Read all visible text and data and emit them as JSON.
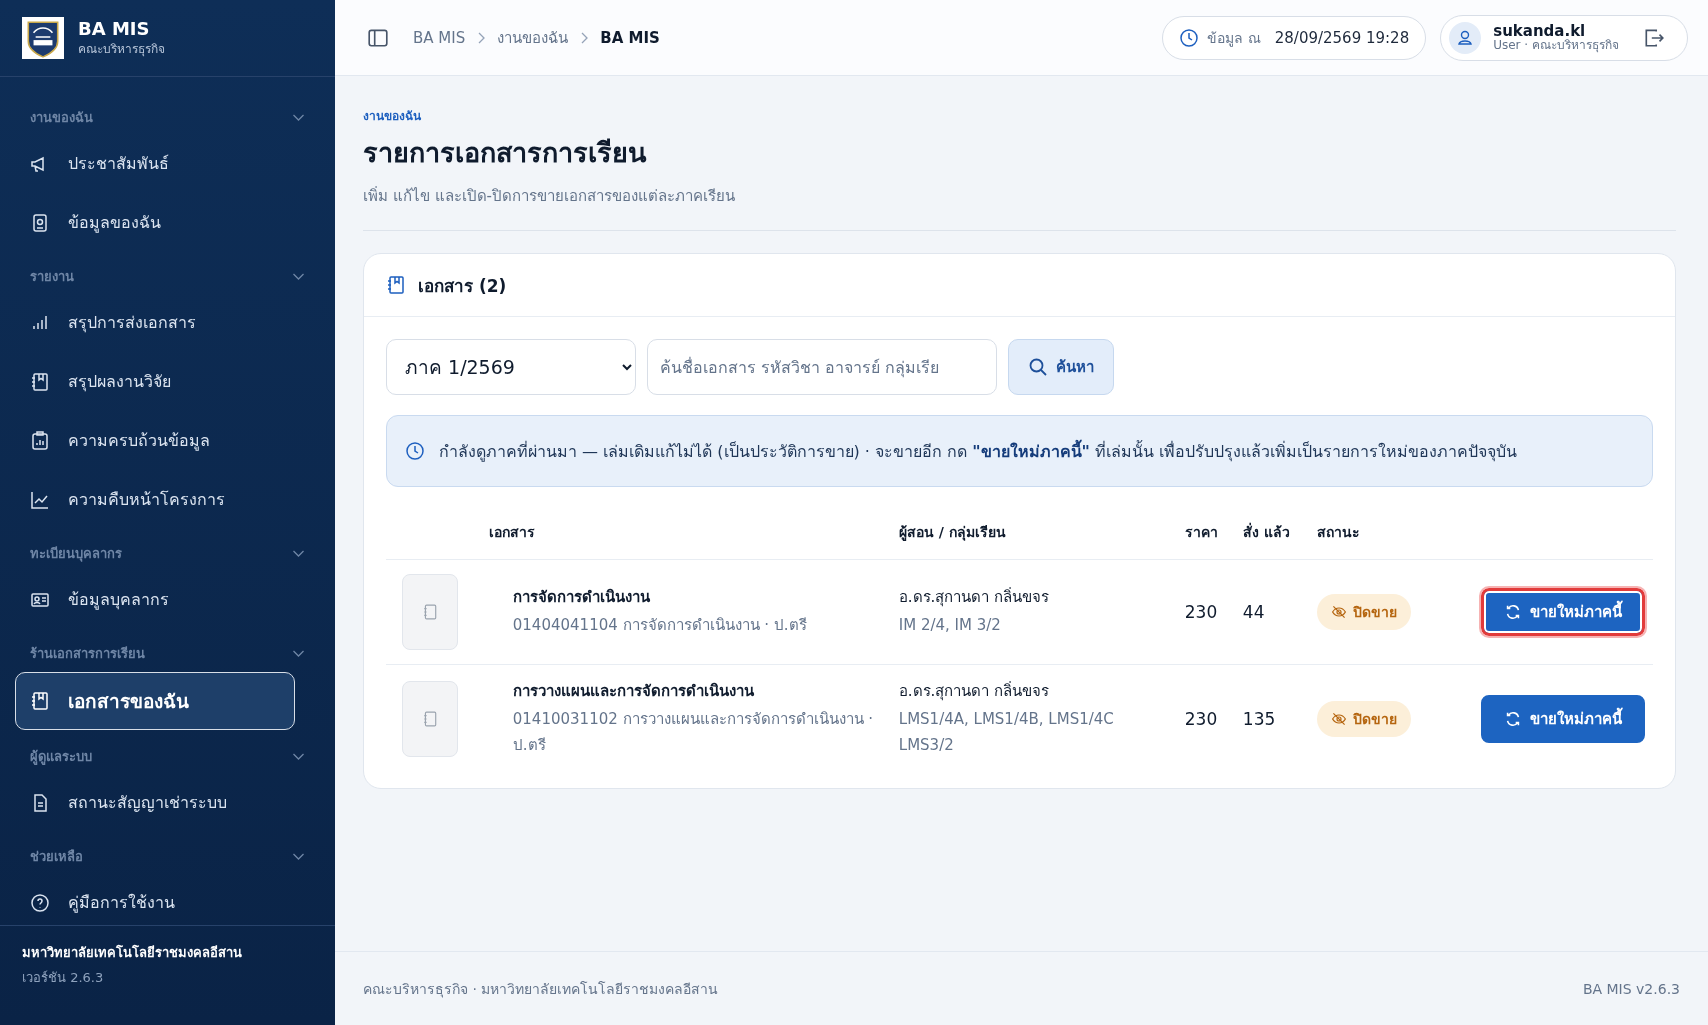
{
  "sidebar": {
    "brand": {
      "title": "BA MIS",
      "subtitle": "คณะบริหารธุรกิจ"
    },
    "sections": [
      {
        "title": "งานของฉัน",
        "expanded": true,
        "items": [
          {
            "label": "ประชาสัมพันธ์",
            "kind": "megaphone",
            "selected": false
          },
          {
            "label": "ข้อมูลของฉัน",
            "kind": "badge",
            "selected": false
          }
        ]
      },
      {
        "title": "รายงาน",
        "expanded": true,
        "items": [
          {
            "label": "สรุปการส่งเอกสาร",
            "kind": "bars",
            "selected": false
          },
          {
            "label": "สรุปผลงานวิจัย",
            "kind": "notebook",
            "selected": false
          },
          {
            "label": "ความครบถ้วนข้อมูล",
            "kind": "clipboard",
            "selected": false
          },
          {
            "label": "ความคืบหน้าโครงการ",
            "kind": "trend",
            "selected": false
          }
        ]
      },
      {
        "title": "ทะเบียนบุคลากร",
        "expanded": true,
        "items": [
          {
            "label": "ข้อมูลบุคลากร",
            "kind": "idcard",
            "selected": false
          }
        ]
      },
      {
        "title": "ร้านเอกสารการเรียน",
        "expanded": true,
        "items": [
          {
            "label": "เอกสารของฉัน",
            "kind": "notebook",
            "selected": true
          }
        ]
      },
      {
        "title": "ผู้ดูแลระบบ",
        "expanded": true,
        "items": [
          {
            "label": "สถานะสัญญาเช่าระบบ",
            "kind": "file",
            "selected": false
          }
        ]
      },
      {
        "title": "ช่วยเหลือ",
        "expanded": true,
        "items": [
          {
            "label": "คู่มือการใช้งาน",
            "kind": "help",
            "selected": false
          }
        ]
      }
    ],
    "footer": {
      "org": "มหาวิทยาลัยเทคโนโลยีราชมงคลอีสาน",
      "version": "เวอร์ชัน 2.6.3"
    }
  },
  "topbar": {
    "breadcrumb": [
      "BA MIS",
      "งานของฉัน",
      "BA MIS"
    ],
    "data_time_label": "ข้อมูล ณ",
    "data_time": "28/09/2569 19:28",
    "user": {
      "name": "sukanda.kl",
      "role": "User · คณะบริหารธุรกิจ"
    }
  },
  "page": {
    "eyebrow": "งานของฉัน",
    "title": "รายการเอกสารการเรียน",
    "subtitle": "เพิ่ม แก้ไข และเปิด-ปิดการขายเอกสารของแต่ละภาคเรียน"
  },
  "card": {
    "title": "เอกสาร (2)",
    "filters": {
      "term": "ภาค 1/2569",
      "search_placeholder": "ค้นชื่อเอกสาร รหัสวิชา อาจารย์ กลุ่มเรีย",
      "search_button": "ค้นหา"
    },
    "notice": "กำลังดูภาคที่ผ่านมา — เล่มเดิมแก้ไม่ได้ (เป็นประวัติการขาย) · จะขายอีก กด **\"ขายใหม่ภาคนี้\"** ที่เล่มนั้น เพื่อปรับปรุงแล้วเพิ่มเป็นรายการใหม่ของภาคปัจจุบัน",
    "table": {
      "columns": [
        "เอกสาร",
        "ผู้สอน / กลุ่มเรียน",
        "ราคา",
        "สั่ง แล้ว",
        "สถานะ"
      ],
      "rows": [
        {
          "title": "การจัดการดำเนินงาน",
          "detail": "01404041104 การจัดการดำเนินงาน · ป.ตรี",
          "teacher": "อ.ดร.สุกานดา กลิ่นขจร",
          "groups": "IM 2/4, IM 3/2",
          "price": "230",
          "ordered": "44",
          "status": "ปิดขาย",
          "action": "ขายใหม่ภาคนี้",
          "highlighted": true
        },
        {
          "title": "การวางแผนและการจัดการดำเนินงาน",
          "detail": "01410031102 การวางแผนและการจัดการดำเนินงาน · ป.ตรี",
          "teacher": "อ.ดร.สุกานดา กลิ่นขจร",
          "groups": "LMS1/4A, LMS1/4B, LMS1/4C LMS3/2",
          "price": "230",
          "ordered": "135",
          "status": "ปิดขาย",
          "action": "ขายใหม่ภาคนี้",
          "highlighted": false
        }
      ]
    }
  },
  "footer": {
    "left": "คณะบริหารธุรกิจ · มหาวิทยาลัยเทคโนโลยีราชมงคลอีสาน",
    "right": "BA MIS v2.6.3"
  }
}
